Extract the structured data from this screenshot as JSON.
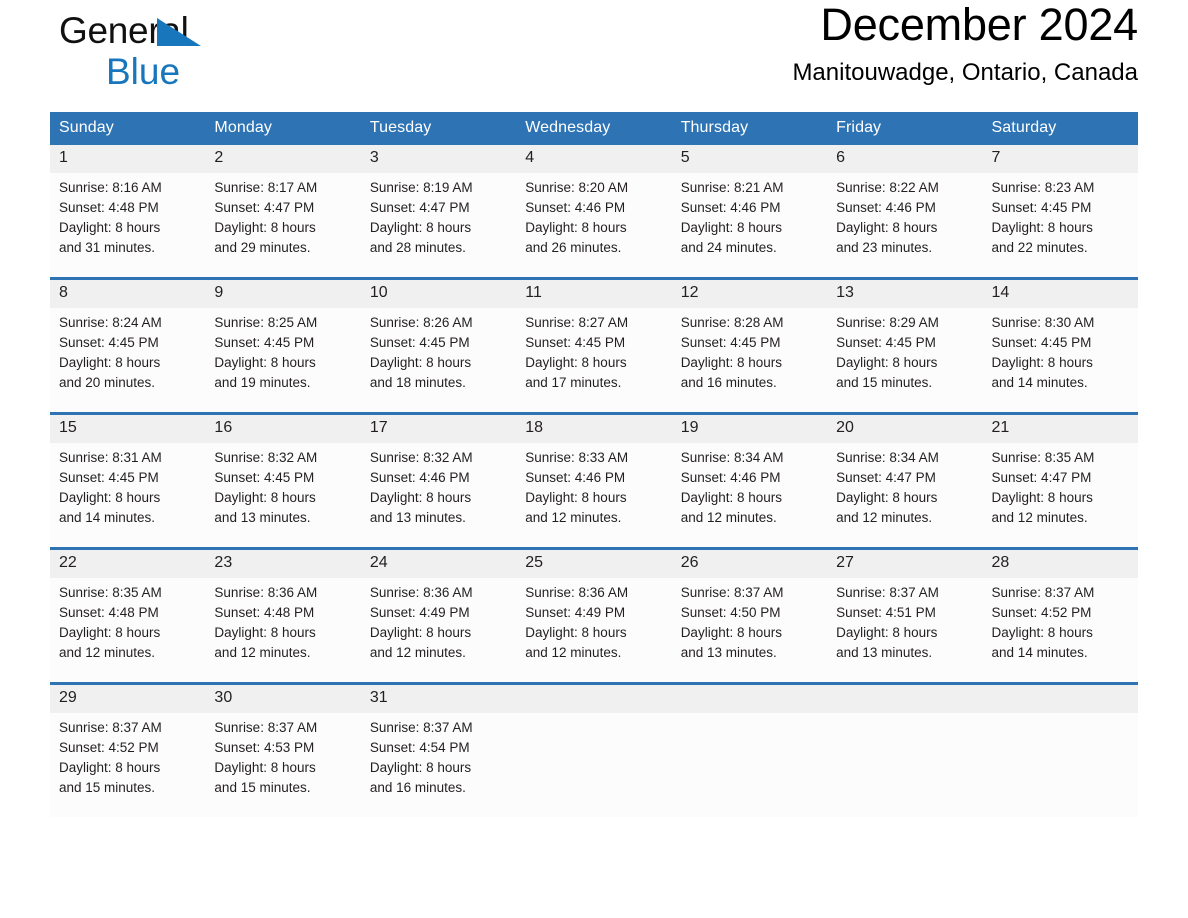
{
  "brand": {
    "name_part1": "General",
    "name_part2": "Blue",
    "triangle_color": "#1876bc"
  },
  "header": {
    "title": "December 2024",
    "subtitle": "Manitouwadge, Ontario, Canada"
  },
  "theme": {
    "header_blue": "#2e74b5",
    "daynum_band": "#f0f0f0",
    "cell_background": "#fcfcfc",
    "text": "#231f20"
  },
  "calendar": {
    "weekday_headers": [
      "Sunday",
      "Monday",
      "Tuesday",
      "Wednesday",
      "Thursday",
      "Friday",
      "Saturday"
    ],
    "weeks": [
      [
        {
          "day": "1",
          "sunrise": "Sunrise: 8:16 AM",
          "sunset": "Sunset: 4:48 PM",
          "daylight_line1": "Daylight: 8 hours",
          "daylight_line2": "and 31 minutes."
        },
        {
          "day": "2",
          "sunrise": "Sunrise: 8:17 AM",
          "sunset": "Sunset: 4:47 PM",
          "daylight_line1": "Daylight: 8 hours",
          "daylight_line2": "and 29 minutes."
        },
        {
          "day": "3",
          "sunrise": "Sunrise: 8:19 AM",
          "sunset": "Sunset: 4:47 PM",
          "daylight_line1": "Daylight: 8 hours",
          "daylight_line2": "and 28 minutes."
        },
        {
          "day": "4",
          "sunrise": "Sunrise: 8:20 AM",
          "sunset": "Sunset: 4:46 PM",
          "daylight_line1": "Daylight: 8 hours",
          "daylight_line2": "and 26 minutes."
        },
        {
          "day": "5",
          "sunrise": "Sunrise: 8:21 AM",
          "sunset": "Sunset: 4:46 PM",
          "daylight_line1": "Daylight: 8 hours",
          "daylight_line2": "and 24 minutes."
        },
        {
          "day": "6",
          "sunrise": "Sunrise: 8:22 AM",
          "sunset": "Sunset: 4:46 PM",
          "daylight_line1": "Daylight: 8 hours",
          "daylight_line2": "and 23 minutes."
        },
        {
          "day": "7",
          "sunrise": "Sunrise: 8:23 AM",
          "sunset": "Sunset: 4:45 PM",
          "daylight_line1": "Daylight: 8 hours",
          "daylight_line2": "and 22 minutes."
        }
      ],
      [
        {
          "day": "8",
          "sunrise": "Sunrise: 8:24 AM",
          "sunset": "Sunset: 4:45 PM",
          "daylight_line1": "Daylight: 8 hours",
          "daylight_line2": "and 20 minutes."
        },
        {
          "day": "9",
          "sunrise": "Sunrise: 8:25 AM",
          "sunset": "Sunset: 4:45 PM",
          "daylight_line1": "Daylight: 8 hours",
          "daylight_line2": "and 19 minutes."
        },
        {
          "day": "10",
          "sunrise": "Sunrise: 8:26 AM",
          "sunset": "Sunset: 4:45 PM",
          "daylight_line1": "Daylight: 8 hours",
          "daylight_line2": "and 18 minutes."
        },
        {
          "day": "11",
          "sunrise": "Sunrise: 8:27 AM",
          "sunset": "Sunset: 4:45 PM",
          "daylight_line1": "Daylight: 8 hours",
          "daylight_line2": "and 17 minutes."
        },
        {
          "day": "12",
          "sunrise": "Sunrise: 8:28 AM",
          "sunset": "Sunset: 4:45 PM",
          "daylight_line1": "Daylight: 8 hours",
          "daylight_line2": "and 16 minutes."
        },
        {
          "day": "13",
          "sunrise": "Sunrise: 8:29 AM",
          "sunset": "Sunset: 4:45 PM",
          "daylight_line1": "Daylight: 8 hours",
          "daylight_line2": "and 15 minutes."
        },
        {
          "day": "14",
          "sunrise": "Sunrise: 8:30 AM",
          "sunset": "Sunset: 4:45 PM",
          "daylight_line1": "Daylight: 8 hours",
          "daylight_line2": "and 14 minutes."
        }
      ],
      [
        {
          "day": "15",
          "sunrise": "Sunrise: 8:31 AM",
          "sunset": "Sunset: 4:45 PM",
          "daylight_line1": "Daylight: 8 hours",
          "daylight_line2": "and 14 minutes."
        },
        {
          "day": "16",
          "sunrise": "Sunrise: 8:32 AM",
          "sunset": "Sunset: 4:45 PM",
          "daylight_line1": "Daylight: 8 hours",
          "daylight_line2": "and 13 minutes."
        },
        {
          "day": "17",
          "sunrise": "Sunrise: 8:32 AM",
          "sunset": "Sunset: 4:46 PM",
          "daylight_line1": "Daylight: 8 hours",
          "daylight_line2": "and 13 minutes."
        },
        {
          "day": "18",
          "sunrise": "Sunrise: 8:33 AM",
          "sunset": "Sunset: 4:46 PM",
          "daylight_line1": "Daylight: 8 hours",
          "daylight_line2": "and 12 minutes."
        },
        {
          "day": "19",
          "sunrise": "Sunrise: 8:34 AM",
          "sunset": "Sunset: 4:46 PM",
          "daylight_line1": "Daylight: 8 hours",
          "daylight_line2": "and 12 minutes."
        },
        {
          "day": "20",
          "sunrise": "Sunrise: 8:34 AM",
          "sunset": "Sunset: 4:47 PM",
          "daylight_line1": "Daylight: 8 hours",
          "daylight_line2": "and 12 minutes."
        },
        {
          "day": "21",
          "sunrise": "Sunrise: 8:35 AM",
          "sunset": "Sunset: 4:47 PM",
          "daylight_line1": "Daylight: 8 hours",
          "daylight_line2": "and 12 minutes."
        }
      ],
      [
        {
          "day": "22",
          "sunrise": "Sunrise: 8:35 AM",
          "sunset": "Sunset: 4:48 PM",
          "daylight_line1": "Daylight: 8 hours",
          "daylight_line2": "and 12 minutes."
        },
        {
          "day": "23",
          "sunrise": "Sunrise: 8:36 AM",
          "sunset": "Sunset: 4:48 PM",
          "daylight_line1": "Daylight: 8 hours",
          "daylight_line2": "and 12 minutes."
        },
        {
          "day": "24",
          "sunrise": "Sunrise: 8:36 AM",
          "sunset": "Sunset: 4:49 PM",
          "daylight_line1": "Daylight: 8 hours",
          "daylight_line2": "and 12 minutes."
        },
        {
          "day": "25",
          "sunrise": "Sunrise: 8:36 AM",
          "sunset": "Sunset: 4:49 PM",
          "daylight_line1": "Daylight: 8 hours",
          "daylight_line2": "and 12 minutes."
        },
        {
          "day": "26",
          "sunrise": "Sunrise: 8:37 AM",
          "sunset": "Sunset: 4:50 PM",
          "daylight_line1": "Daylight: 8 hours",
          "daylight_line2": "and 13 minutes."
        },
        {
          "day": "27",
          "sunrise": "Sunrise: 8:37 AM",
          "sunset": "Sunset: 4:51 PM",
          "daylight_line1": "Daylight: 8 hours",
          "daylight_line2": "and 13 minutes."
        },
        {
          "day": "28",
          "sunrise": "Sunrise: 8:37 AM",
          "sunset": "Sunset: 4:52 PM",
          "daylight_line1": "Daylight: 8 hours",
          "daylight_line2": "and 14 minutes."
        }
      ],
      [
        {
          "day": "29",
          "sunrise": "Sunrise: 8:37 AM",
          "sunset": "Sunset: 4:52 PM",
          "daylight_line1": "Daylight: 8 hours",
          "daylight_line2": "and 15 minutes."
        },
        {
          "day": "30",
          "sunrise": "Sunrise: 8:37 AM",
          "sunset": "Sunset: 4:53 PM",
          "daylight_line1": "Daylight: 8 hours",
          "daylight_line2": "and 15 minutes."
        },
        {
          "day": "31",
          "sunrise": "Sunrise: 8:37 AM",
          "sunset": "Sunset: 4:54 PM",
          "daylight_line1": "Daylight: 8 hours",
          "daylight_line2": "and 16 minutes."
        },
        {
          "day": "",
          "sunrise": "",
          "sunset": "",
          "daylight_line1": "",
          "daylight_line2": ""
        },
        {
          "day": "",
          "sunrise": "",
          "sunset": "",
          "daylight_line1": "",
          "daylight_line2": ""
        },
        {
          "day": "",
          "sunrise": "",
          "sunset": "",
          "daylight_line1": "",
          "daylight_line2": ""
        },
        {
          "day": "",
          "sunrise": "",
          "sunset": "",
          "daylight_line1": "",
          "daylight_line2": ""
        }
      ]
    ]
  }
}
